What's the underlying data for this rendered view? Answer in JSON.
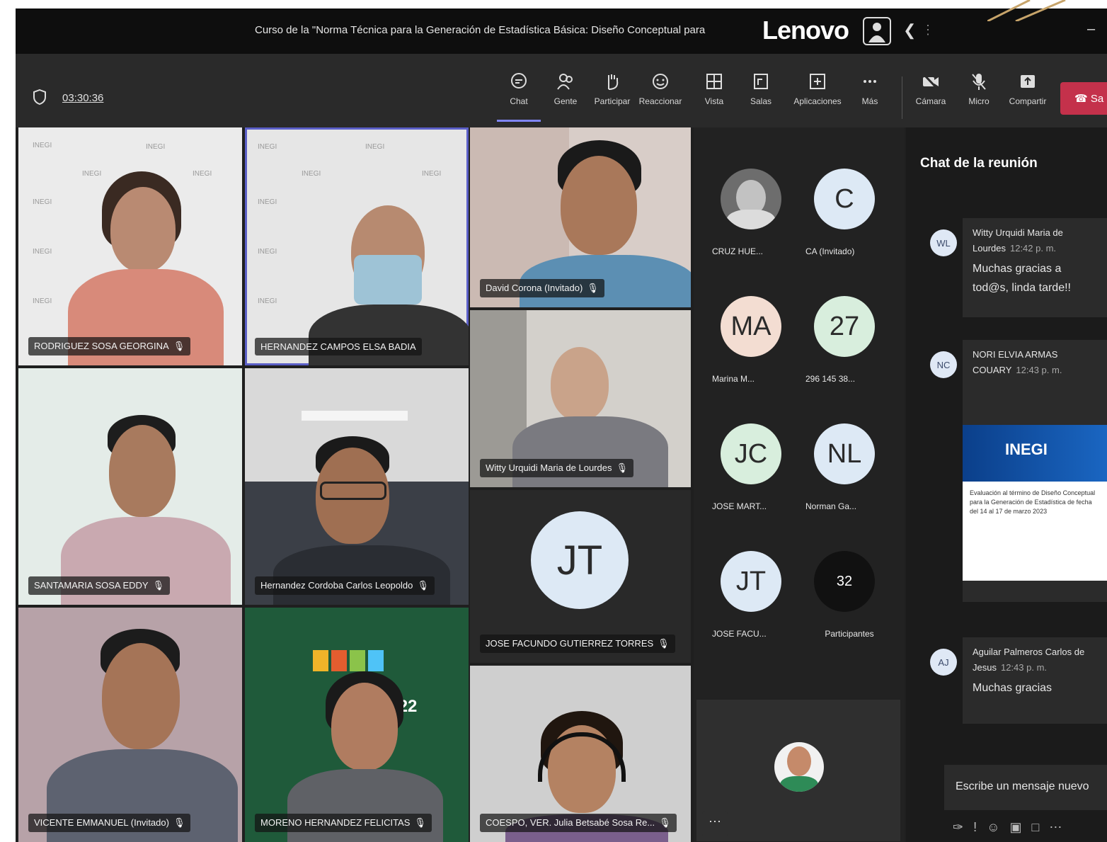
{
  "window": {
    "title": "Curso de la \"Norma Técnica para la Generación de Estadística Básica: Diseño Conceptual para",
    "brand": "Lenovo"
  },
  "toolbar": {
    "timer": "03:30:36",
    "buttons": [
      {
        "label": "Chat",
        "icon": "chat-icon",
        "active": true
      },
      {
        "label": "Gente",
        "icon": "people-icon"
      },
      {
        "label": "Participar",
        "icon": "raise-hand-icon"
      },
      {
        "label": "Reaccionar",
        "icon": "smile-icon"
      },
      {
        "label": "Vista",
        "icon": "grid-icon"
      },
      {
        "label": "Salas",
        "icon": "rooms-icon"
      },
      {
        "label": "Aplicaciones",
        "icon": "add-app-icon"
      },
      {
        "label": "Más",
        "icon": "more-icon"
      },
      {
        "label": "Cámara",
        "icon": "camera-off-icon"
      },
      {
        "label": "Micro",
        "icon": "mic-off-icon"
      },
      {
        "label": "Compartir",
        "icon": "share-icon"
      }
    ],
    "leave_label": "Sa"
  },
  "tiles": [
    {
      "name": "RODRIGUEZ SOSA GEORGINA"
    },
    {
      "name": "HERNANDEZ CAMPOS ELSA BADIA"
    },
    {
      "name": "David Corona (Invitado)"
    },
    {
      "name": "SANTAMARIA SOSA EDDY"
    },
    {
      "name": "Hernandez Cordoba Carlos Leopoldo"
    },
    {
      "name": "Witty Urquidi Maria de Lourdes"
    },
    {
      "name": "JOSE FACUNDO GUTIERREZ TORRES",
      "initials": "JT"
    },
    {
      "name": "VICENTE EMMANUEL (Invitado)"
    },
    {
      "name": "MORENO HERNANDEZ FELICITAS"
    },
    {
      "name": "COESPO, VER. Julia Betsabé Sosa Re..."
    }
  ],
  "watermark": "INEGI",
  "poster_text": "2022",
  "avatars": [
    {
      "label": "CRUZ HUE...",
      "initials": "",
      "color": "#6d6d6d"
    },
    {
      "label": "CA (Invitado)",
      "initials": "C",
      "color": "#dde9f5"
    },
    {
      "label": "Marina M...",
      "initials": "MA",
      "color": "#f3ddd2"
    },
    {
      "label": "296 145 38...",
      "initials": "27",
      "color": "#d8eedd"
    },
    {
      "label": "JOSE MART...",
      "initials": "JC",
      "color": "#d8eedd"
    },
    {
      "label": "Norman Ga...",
      "initials": "NL",
      "color": "#dde9f5"
    },
    {
      "label": "JOSE FACU...",
      "initials": "JT",
      "color": "#dde9f5"
    },
    {
      "label": "Participantes",
      "initials": "32",
      "color": "#111111"
    }
  ],
  "chat": {
    "title": "Chat de la reunión",
    "messages": [
      {
        "initials": "WL",
        "author": "Witty Urquidi Maria de Lourdes",
        "time": "12:42 p. m.",
        "text": "Muchas gracias a tod@s, linda tarde!!"
      },
      {
        "initials": "NC",
        "author": "NORI ELVIA ARMAS COUARY",
        "time": "12:43 p. m.",
        "text": ""
      },
      {
        "initials": "AJ",
        "author": "Aguilar Palmeros Carlos de Jesus",
        "time": "12:43 p. m.",
        "text": "Muchas gracias"
      }
    ],
    "attachment": {
      "brand": "INEGI",
      "body": "Evaluación al término de Diseño Conceptual para la Generación de Estadística de fecha del 14 al 17 de marzo 2023"
    },
    "compose_placeholder": "Escribe un mensaje nuevo"
  }
}
